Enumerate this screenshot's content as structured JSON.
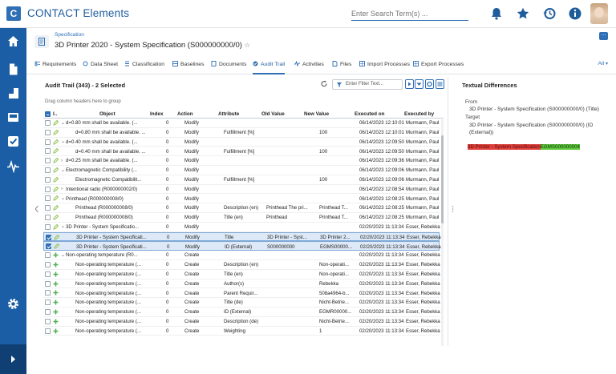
{
  "app": {
    "logo_letter": "C",
    "title": "CONTACT Elements"
  },
  "search": {
    "placeholder": "Enter Search Term(s) ..."
  },
  "topbar_icons": [
    "bell-icon",
    "star-icon",
    "history-icon",
    "info-icon"
  ],
  "colors": {
    "brand": "#1b5ea5",
    "accent": "#2f6fb5",
    "diff_deleted": "#e0413c",
    "diff_inserted": "#5fc93f",
    "create_icon": "#4caf50",
    "modify_icon": "#8bc34a"
  },
  "sidebar": {
    "items": [
      "home-icon",
      "document-icon",
      "hierarchy-icon",
      "inbox-icon",
      "checklist-icon",
      "activity-icon"
    ],
    "bottom": [
      "settings-icon",
      "expand-icon"
    ]
  },
  "header": {
    "breadcrumb": "Specification",
    "title": "3D Printer 2020 - System Specification (S000000000/0)",
    "star": "☆",
    "menu": "…"
  },
  "tabs": [
    {
      "label": "Requirements",
      "icon": "requirements-icon"
    },
    {
      "label": "Data Sheet",
      "icon": "datasheet-icon"
    },
    {
      "label": "Classification",
      "icon": "classification-icon"
    },
    {
      "label": "Baselines",
      "icon": "baselines-icon"
    },
    {
      "label": "Documents",
      "icon": "documents-icon"
    },
    {
      "label": "Audit Trail",
      "icon": "audit-icon",
      "active": true
    },
    {
      "label": "Activities",
      "icon": "activities-icon"
    },
    {
      "label": "Files",
      "icon": "files-icon"
    },
    {
      "label": "Import Processes",
      "icon": "import-icon"
    },
    {
      "label": "Export Processes",
      "icon": "export-icon"
    }
  ],
  "tabs_all": "All",
  "audit": {
    "title": "Audit Trail (343) - 2 Selected",
    "filter_placeholder": "Enter Filter Text...",
    "drag_hint": "Drag column headers here to group",
    "columns": [
      "I..",
      "Object",
      "Index",
      "Action",
      "Attribute",
      "Old Value",
      "New Value",
      "Executed on",
      "Executed by"
    ],
    "rows": [
      {
        "checked": false,
        "selected": false,
        "icon": "modify",
        "indent": 1,
        "expander": "v",
        "object": "d=0.80 mm shall be available. (...",
        "index": "0",
        "action": "Modify",
        "attribute": "",
        "old": "",
        "new": "",
        "on": "06/14/2023 12:10:01",
        "by": "Murmann, Paul"
      },
      {
        "checked": false,
        "selected": false,
        "icon": "modify",
        "indent": 2,
        "expander": "",
        "object": "d=0.80 mm shall be available. ...",
        "index": "0",
        "action": "Modify",
        "attribute": "Fulfillment [%]",
        "old": "",
        "new": "100",
        "on": "06/14/2023 12:10:01",
        "by": "Murmann, Paul"
      },
      {
        "checked": false,
        "selected": false,
        "icon": "modify",
        "indent": 1,
        "expander": "v",
        "object": "d=0.40 mm shall be available. (...",
        "index": "0",
        "action": "Modify",
        "attribute": "",
        "old": "",
        "new": "",
        "on": "06/14/2023 12:09:50",
        "by": "Murmann, Paul"
      },
      {
        "checked": false,
        "selected": false,
        "icon": "modify",
        "indent": 2,
        "expander": "",
        "object": "d=0.40 mm shall be available. ...",
        "index": "0",
        "action": "Modify",
        "attribute": "Fulfillment [%]",
        "old": "",
        "new": "100",
        "on": "06/14/2023 12:09:50",
        "by": "Murmann, Paul"
      },
      {
        "checked": false,
        "selected": false,
        "icon": "modify",
        "indent": 1,
        "expander": ">",
        "object": "d=0.25 mm shall be available. (...",
        "index": "0",
        "action": "Modify",
        "attribute": "",
        "old": "",
        "new": "",
        "on": "06/14/2023 12:09:36",
        "by": "Murmann, Paul"
      },
      {
        "checked": false,
        "selected": false,
        "icon": "modify",
        "indent": 1,
        "expander": "v",
        "object": "Electromagnetic Compatibility (...",
        "index": "0",
        "action": "Modify",
        "attribute": "",
        "old": "",
        "new": "",
        "on": "06/14/2023 12:09:06",
        "by": "Murmann, Paul"
      },
      {
        "checked": false,
        "selected": false,
        "icon": "modify",
        "indent": 2,
        "expander": "",
        "object": "Electromagnetic Compatibilit...",
        "index": "0",
        "action": "Modify",
        "attribute": "Fulfillment [%]",
        "old": "",
        "new": "100",
        "on": "06/14/2023 12:09:06",
        "by": "Murmann, Paul"
      },
      {
        "checked": false,
        "selected": false,
        "icon": "modify",
        "indent": 1,
        "expander": ">",
        "object": "Intentional radio (R000000002/0)",
        "index": "0",
        "action": "Modify",
        "attribute": "",
        "old": "",
        "new": "",
        "on": "06/14/2023 12:08:54",
        "by": "Murmann, Paul"
      },
      {
        "checked": false,
        "selected": false,
        "icon": "modify",
        "indent": 1,
        "expander": "v",
        "object": "Printhead (R000000008/0)",
        "index": "0",
        "action": "Modify",
        "attribute": "",
        "old": "",
        "new": "",
        "on": "06/14/2023 12:08:25",
        "by": "Murmann, Paul"
      },
      {
        "checked": false,
        "selected": false,
        "icon": "modify",
        "indent": 2,
        "expander": "",
        "object": "Printhead (R000000008/0)",
        "index": "0",
        "action": "Modify",
        "attribute": "Description (en)",
        "old": "Printhead The pri...",
        "new": "Printhead T...",
        "on": "06/14/2023 12:08:25",
        "by": "Murmann, Paul"
      },
      {
        "checked": false,
        "selected": false,
        "icon": "modify",
        "indent": 2,
        "expander": "",
        "object": "Printhead (R000000008/0)",
        "index": "0",
        "action": "Modify",
        "attribute": "Title (en)",
        "old": "Printhead",
        "new": "Printhead T...",
        "on": "06/14/2023 12:08:25",
        "by": "Murmann, Paul"
      },
      {
        "checked": false,
        "selected": false,
        "icon": "modify",
        "indent": 1,
        "expander": "v",
        "object": "3D Printer - System Specificatio...",
        "index": "0",
        "action": "Modify",
        "attribute": "",
        "old": "",
        "new": "",
        "on": "02/20/2023 11:13:34",
        "by": "Esser, Rebekka"
      },
      {
        "checked": true,
        "selected": true,
        "icon": "modify",
        "indent": 2,
        "expander": "",
        "object": "3D Printer - System Specificati...",
        "index": "0",
        "action": "Modify",
        "attribute": "Title",
        "old": "3D Printer - Syst...",
        "new": "3D Printer 2...",
        "on": "02/20/2023 11:13:34",
        "by": "Esser, Rebekka"
      },
      {
        "checked": true,
        "selected": true,
        "icon": "modify",
        "indent": 2,
        "expander": "",
        "object": "3D Printer - System Specificati...",
        "index": "0",
        "action": "Modify",
        "attribute": "ID (External)",
        "old": "S000000000",
        "new": "EGMS00000...",
        "on": "02/20/2023 11:13:34",
        "by": "Esser, Rebekka"
      },
      {
        "checked": false,
        "selected": false,
        "icon": "create",
        "indent": 1,
        "expander": "v",
        "object": "Non-operating temperature (R0...",
        "index": "0",
        "action": "Create",
        "attribute": "",
        "old": "",
        "new": "",
        "on": "02/20/2023 11:13:34",
        "by": "Esser, Rebekka"
      },
      {
        "checked": false,
        "selected": false,
        "icon": "create",
        "indent": 2,
        "expander": "",
        "object": "Non-operating temperature (...",
        "index": "0",
        "action": "Create",
        "attribute": "Description (en)",
        "old": "",
        "new": "Non-operati...",
        "on": "02/20/2023 11:13:34",
        "by": "Esser, Rebekka"
      },
      {
        "checked": false,
        "selected": false,
        "icon": "create",
        "indent": 2,
        "expander": "",
        "object": "Non-operating temperature (...",
        "index": "0",
        "action": "Create",
        "attribute": "Title (en)",
        "old": "",
        "new": "Non-operati...",
        "on": "02/20/2023 11:13:34",
        "by": "Esser, Rebekka"
      },
      {
        "checked": false,
        "selected": false,
        "icon": "create",
        "indent": 2,
        "expander": "",
        "object": "Non-operating temperature (...",
        "index": "0",
        "action": "Create",
        "attribute": "Author(s)",
        "old": "",
        "new": "Rebekka",
        "on": "02/20/2023 11:13:34",
        "by": "Esser, Rebekka"
      },
      {
        "checked": false,
        "selected": false,
        "icon": "create",
        "indent": 2,
        "expander": "",
        "object": "Non-operating temperature (...",
        "index": "0",
        "action": "Create",
        "attribute": "Parent Requir...",
        "old": "",
        "new": "508a4964-b...",
        "on": "02/20/2023 11:13:34",
        "by": "Esser, Rebekka"
      },
      {
        "checked": false,
        "selected": false,
        "icon": "create",
        "indent": 2,
        "expander": "",
        "object": "Non-operating temperature (...",
        "index": "0",
        "action": "Create",
        "attribute": "Title (de)",
        "old": "",
        "new": "Nicht-Betrie...",
        "on": "02/20/2023 11:13:34",
        "by": "Esser, Rebekka"
      },
      {
        "checked": false,
        "selected": false,
        "icon": "create",
        "indent": 2,
        "expander": "",
        "object": "Non-operating temperature (...",
        "index": "0",
        "action": "Create",
        "attribute": "ID (External)",
        "old": "",
        "new": "EGMR00000...",
        "on": "02/20/2023 11:13:34",
        "by": "Esser, Rebekka"
      },
      {
        "checked": false,
        "selected": false,
        "icon": "create",
        "indent": 2,
        "expander": "",
        "object": "Non-operating temperature (...",
        "index": "0",
        "action": "Create",
        "attribute": "Description (de)",
        "old": "",
        "new": "Nicht-Betrie...",
        "on": "02/20/2023 11:13:34",
        "by": "Esser, Rebekka"
      },
      {
        "checked": false,
        "selected": false,
        "icon": "create",
        "indent": 2,
        "expander": "",
        "object": "Non-operating temperature (...",
        "index": "0",
        "action": "Create",
        "attribute": "Weighting",
        "old": "",
        "new": "1",
        "on": "02/20/2023 11:13:34",
        "by": "Esser, Rebekka"
      }
    ]
  },
  "diff": {
    "title": "Textual Differences",
    "from_label": "From",
    "from_value": "3D Printer - System Specification (S000000000/0) (Title)",
    "target_label": "Target",
    "target_value": "3D Printer - System Specification (S000000000/0) (ID (External))",
    "deleted": "3D Printer - System Specification",
    "inserted": "EGMS000000004"
  }
}
